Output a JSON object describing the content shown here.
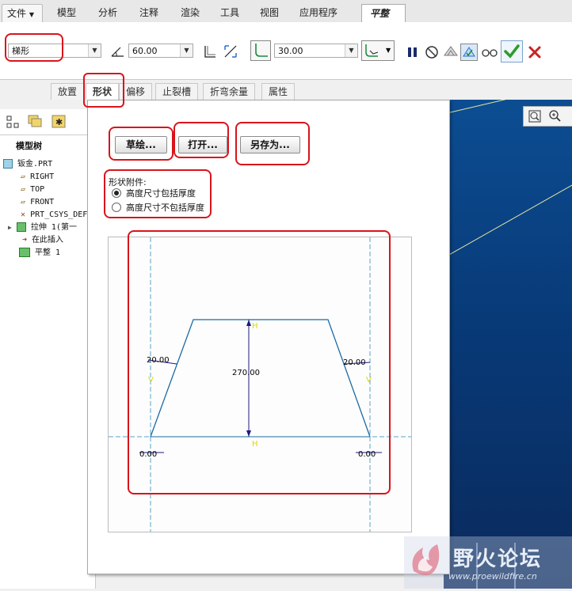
{
  "menu": {
    "file": "文件",
    "tabs": [
      "模型",
      "分析",
      "注释",
      "渲染",
      "工具",
      "视图",
      "应用程序"
    ],
    "active_tab": "平整"
  },
  "ribbon": {
    "shape_select": "梯形",
    "angle_value": "60.00",
    "radius_value": "30.00"
  },
  "sub_tabs": [
    "放置",
    "形状",
    "偏移",
    "止裂槽",
    "折弯余量",
    "属性"
  ],
  "active_sub_tab_index": 1,
  "tree": {
    "title": "模型树",
    "items": [
      "钣金.PRT",
      "RIGHT",
      "TOP",
      "FRONT",
      "PRT_CSYS_DEF",
      "拉伸 1(第一",
      "在此插入",
      "平整 1"
    ]
  },
  "popup": {
    "sketch_button": "草绘...",
    "open_button": "打开...",
    "saveas_button": "另存为...",
    "attach_label": "形状附件:",
    "option_include": "高度尺寸包括厚度",
    "option_exclude": "高度尺寸不包括厚度",
    "selected_option": "include"
  },
  "sketch": {
    "height_dim": "270.00",
    "left_dim": "20.00",
    "right_dim": "20.00",
    "left_zero": "0.00",
    "right_zero": "0.00",
    "h_label": "H",
    "v_label": "V"
  },
  "watermark": {
    "title": "野火论坛",
    "url": "www.proewildfire.cn"
  },
  "colors": {
    "annotation_red": "#d9141b",
    "graphics_blue": "#0c4d92",
    "confirm_green": "#2a9d2a",
    "cancel_red": "#cc2222"
  }
}
